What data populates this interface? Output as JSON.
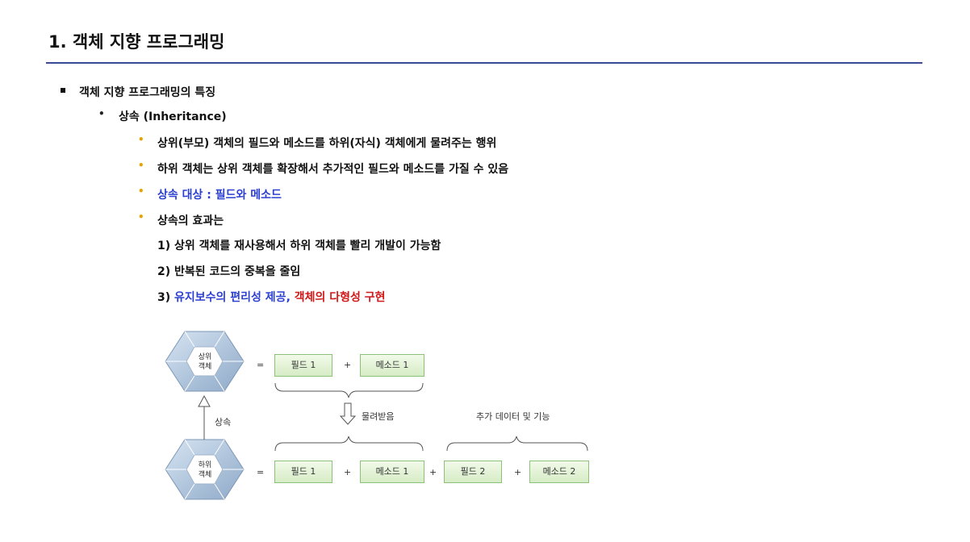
{
  "page_title": "1. 객체 지향 프로그래밍",
  "content": {
    "l1": "객체 지향 프로그래밍의 특징",
    "l2": "상속 (Inheritance)",
    "l3a": "상위(부모) 객체의 필드와 메소드를 하위(자식) 객체에게 물려주는 행위",
    "l3b": "하위 객체는 상위 객체를 확장해서 추가적인 필드와 메소드를 가질 수 있음",
    "l3c": "상속 대상 : 필드와 메소드",
    "l3d": "상속의 효과는",
    "e1": "1) 상위 객체를 재사용해서 하위 객체를 빨리 개발이 가능함",
    "e2": "2) 반복된 코드의 중복을 줄임",
    "e3_prefix": "3) ",
    "e3_blue": "유지보수의 편리성 제공,",
    "e3_red": " 객체의 다형성 구현"
  },
  "diagram": {
    "top_hex_line1": "상위",
    "top_hex_line2": "객체",
    "bottom_hex_line1": "하위",
    "bottom_hex_line2": "객체",
    "equals": "=",
    "plus": "+",
    "field1": "필드 1",
    "method1": "메소드 1",
    "field2": "필드 2",
    "method2": "메소드 2",
    "inherit_label": "상속",
    "received_label": "물려받음",
    "additional_label": "추가 데이터 및 기능"
  },
  "colors": {
    "rule": "#3a4a94",
    "highlight_blue": "#2b3fd0",
    "highlight_red": "#d01818",
    "sub_bullet": "#e8a200",
    "box_border": "#8dc07a"
  }
}
